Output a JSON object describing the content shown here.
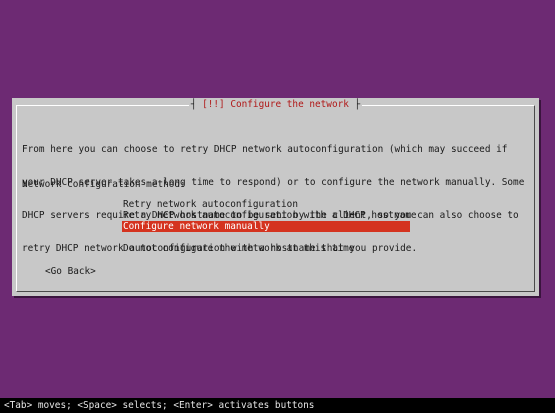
{
  "dialog": {
    "title_left": "[!!]",
    "title_text": "Configure the network",
    "paragraph_lines": [
      "From here you can choose to retry DHCP network autoconfiguration (which may succeed if",
      "your DHCP server takes a long time to respond) or to configure the network manually. Some",
      "DHCP servers require a DHCP hostname to be sent by the client, so you can also choose to",
      "retry DHCP network autoconfiguration with a hostname that you provide."
    ],
    "method_label": "Network configuration method:",
    "options": [
      "Retry network autoconfiguration",
      "Retry network autoconfiguration with a DHCP hostname",
      "Configure network manually",
      "Do not configure the network at this time"
    ],
    "go_back": "<Go Back>"
  },
  "status_bar": "<Tab> moves; <Space> selects; <Enter> activates buttons",
  "colors": {
    "background": "#6d2a73",
    "dialog": "#c8c8c8",
    "selection": "#d4331f",
    "title": "#b01818"
  }
}
